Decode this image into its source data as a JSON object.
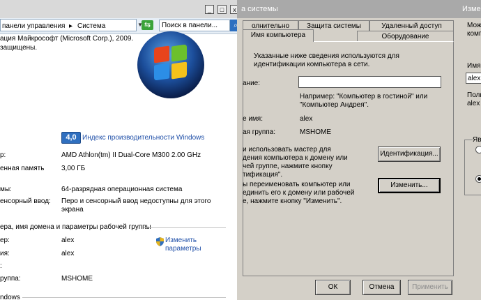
{
  "system_window": {
    "breadcrumb": "панели управления",
    "breadcrumb_sep": "▸",
    "breadcrumb_current": "Система",
    "search_placeholder": "Поиск в панели...",
    "title_buttons": [
      "_",
      "□",
      "x"
    ],
    "copyright_line": "ация Майкрософт (Microsoft Corp.), 2009.",
    "rights_line": "защищены.",
    "wei_score": "4,0",
    "wei_link": "Индекс производительности Windows",
    "rows": [
      {
        "label": "р:",
        "value": "AMD Athlon(tm) II Dual-Core M300   2.00 GHz"
      },
      {
        "label": "енная память",
        "value": "3,00 ГБ"
      },
      {
        "label": "мы:",
        "value": "64-разрядная операционная система"
      },
      {
        "label": "енсорный ввод:",
        "value": "Перо и сенсорный ввод недоступны для этого"
      },
      {
        "label": "",
        "value": "экрана"
      }
    ],
    "section_header": "ера, имя домена и параметры рабочей группы",
    "name_rows": [
      {
        "label": "ер:",
        "value": "alex"
      },
      {
        "label": "ия:",
        "value": "alex"
      },
      {
        "label": ":",
        "value": ""
      },
      {
        "label": "руппа:",
        "value": "MSHOME"
      }
    ],
    "change_link_1": "Изменить",
    "change_link_2": "параметры",
    "bottom_header": "ndows",
    "colors": {
      "link": "#1f4fa8",
      "address_bar": "#e6eef6"
    }
  },
  "properties_window": {
    "title": "а системы",
    "tabs_back": [
      "олнительно",
      "Защита системы",
      "Удаленный доступ"
    ],
    "tabs_front": [
      "Имя компьютера",
      "Оборудование"
    ],
    "intro": [
      "Указанные ниже сведения используются для",
      "идентификации компьютера в сети."
    ],
    "desc_label": "ание:",
    "example": [
      "Например: \"Компьютер в гостиной\" или",
      "\"Компьютер Андрея\"."
    ],
    "full_name_label": "е имя:",
    "full_name_value": "alex",
    "workgroup_label": "ая группа:",
    "workgroup_value": "MSHOME",
    "wizard_text": [
      "и использовать мастер для",
      "дения компьютера к домену или",
      "чей группе, нажмите кнопку",
      "тификация\"."
    ],
    "identify_button": "Идентификация...",
    "rename_text": [
      "ы переименовать компьютер или",
      "единить его к домену или рабочей",
      "е, нажмите кнопку \"Изменить\"."
    ],
    "change_button": "Изменить...",
    "ok": "ОК",
    "cancel": "Отмена",
    "apply": "Применить"
  },
  "rename_window": {
    "title": "Измен",
    "line1": "Можн",
    "line2": "компь",
    "name_label": "Имя",
    "name_value": "alex",
    "full_label": "Полн",
    "full_value": "alex",
    "member_label": "Яв"
  }
}
